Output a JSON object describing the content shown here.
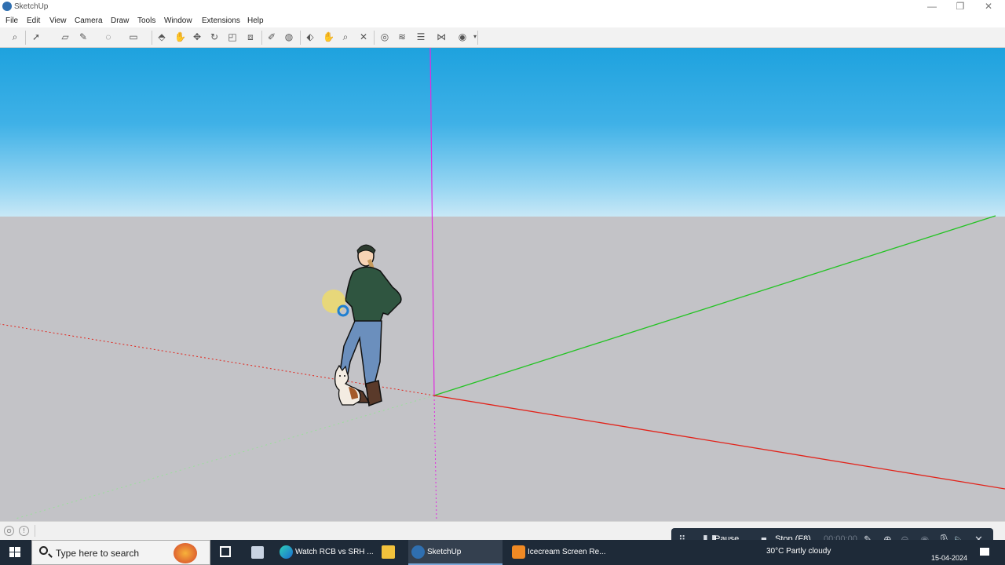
{
  "window": {
    "title": "SketchUp",
    "minimize_label": "—",
    "maximize_label": "❐",
    "close_label": "✕"
  },
  "menu": [
    "File",
    "Edit",
    "View",
    "Camera",
    "Draw",
    "Tools",
    "Window",
    "Extensions",
    "Help"
  ],
  "toolbar": {
    "icons": [
      "search-icon",
      "select-arrow-icon",
      "eraser-icon",
      "pencil-icon",
      "shape-icon",
      "rectangle-icon",
      "push-pull-icon",
      "follow-me-icon",
      "move-icon",
      "rotate-icon",
      "scale-icon",
      "offset-icon",
      "tape-measure-icon",
      "protractor-icon",
      "orbit-icon",
      "pan-icon",
      "zoom-icon",
      "zoom-extents-icon",
      "section-icon",
      "xray-icon",
      "layers-icon",
      "styles-icon",
      "warehouse-icon"
    ]
  },
  "colors": {
    "sky_top": "#1ea2de",
    "ground": "#c3c3c7",
    "axis_red": "#e2231a",
    "axis_green": "#22c322",
    "axis_blue": "#e02ce0",
    "taskbar": "#1e2a38"
  },
  "taskbar": {
    "search_placeholder": "Type here to search",
    "items": [
      {
        "label": "Watch RCB vs SRH ...",
        "icon": "edge-icon"
      },
      {
        "label": "",
        "icon": "file-explorer-icon"
      },
      {
        "label": "SketchUp",
        "icon": "sketchup-icon"
      },
      {
        "label": "Icecream Screen Re...",
        "icon": "icecream-icon"
      }
    ],
    "weather": "30°C  Partly cloudy",
    "date": "15-04-2024"
  },
  "recorder": {
    "pause_label": "Pause",
    "stop_label": "Stop (F8)",
    "timer": "00:00:00"
  }
}
